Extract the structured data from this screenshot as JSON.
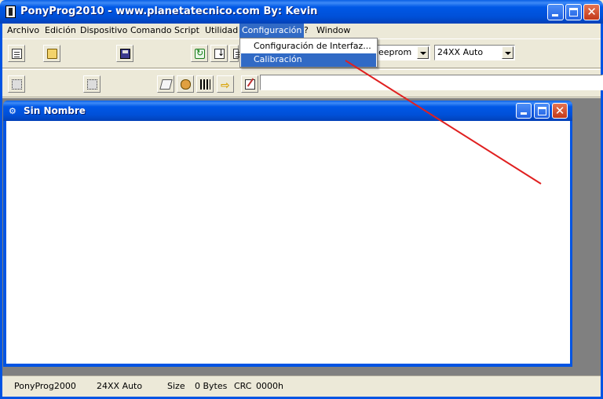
{
  "window": {
    "title": "PonyProg2010 - www.planetatecnico.com By: Kevin",
    "min_label": "minimize",
    "max_label": "maximize",
    "close_glyph": "✕"
  },
  "menubar": {
    "items": [
      "Archivo",
      "Edición",
      "Dispositivo",
      "Comando",
      "Script",
      "Utilidad",
      "Configuración",
      "?",
      "Window"
    ],
    "active": "Configuración"
  },
  "dropdown": {
    "items": [
      "Configuración de Interfaz...",
      "Calibración"
    ],
    "highlighted": "Calibración"
  },
  "toolbar": {
    "family_select": "eeprom",
    "device_select": "24XX Auto",
    "icons_row1": [
      "new-document-icon",
      "open-folder-icon",
      "save-disk-icon",
      "reload-icon",
      "sort-icon",
      "print-icon"
    ],
    "icons_row2": [
      "read-device-icon",
      "write-device-icon",
      "erase-icon",
      "lock-icon",
      "memory-grid-icon",
      "arrow-right-icon",
      "script-edit-icon"
    ]
  },
  "child_window": {
    "title": "Sin Nombre"
  },
  "statusbar": {
    "app": "PonyProg2000",
    "device": "24XX Auto",
    "size_label": "Size",
    "size_value": "0 Bytes",
    "crc_label": "CRC",
    "crc_value": "0000h"
  },
  "colors": {
    "titlebar": "#0054E3",
    "menu_highlight": "#316AC5",
    "annotation_line": "#E02020"
  }
}
